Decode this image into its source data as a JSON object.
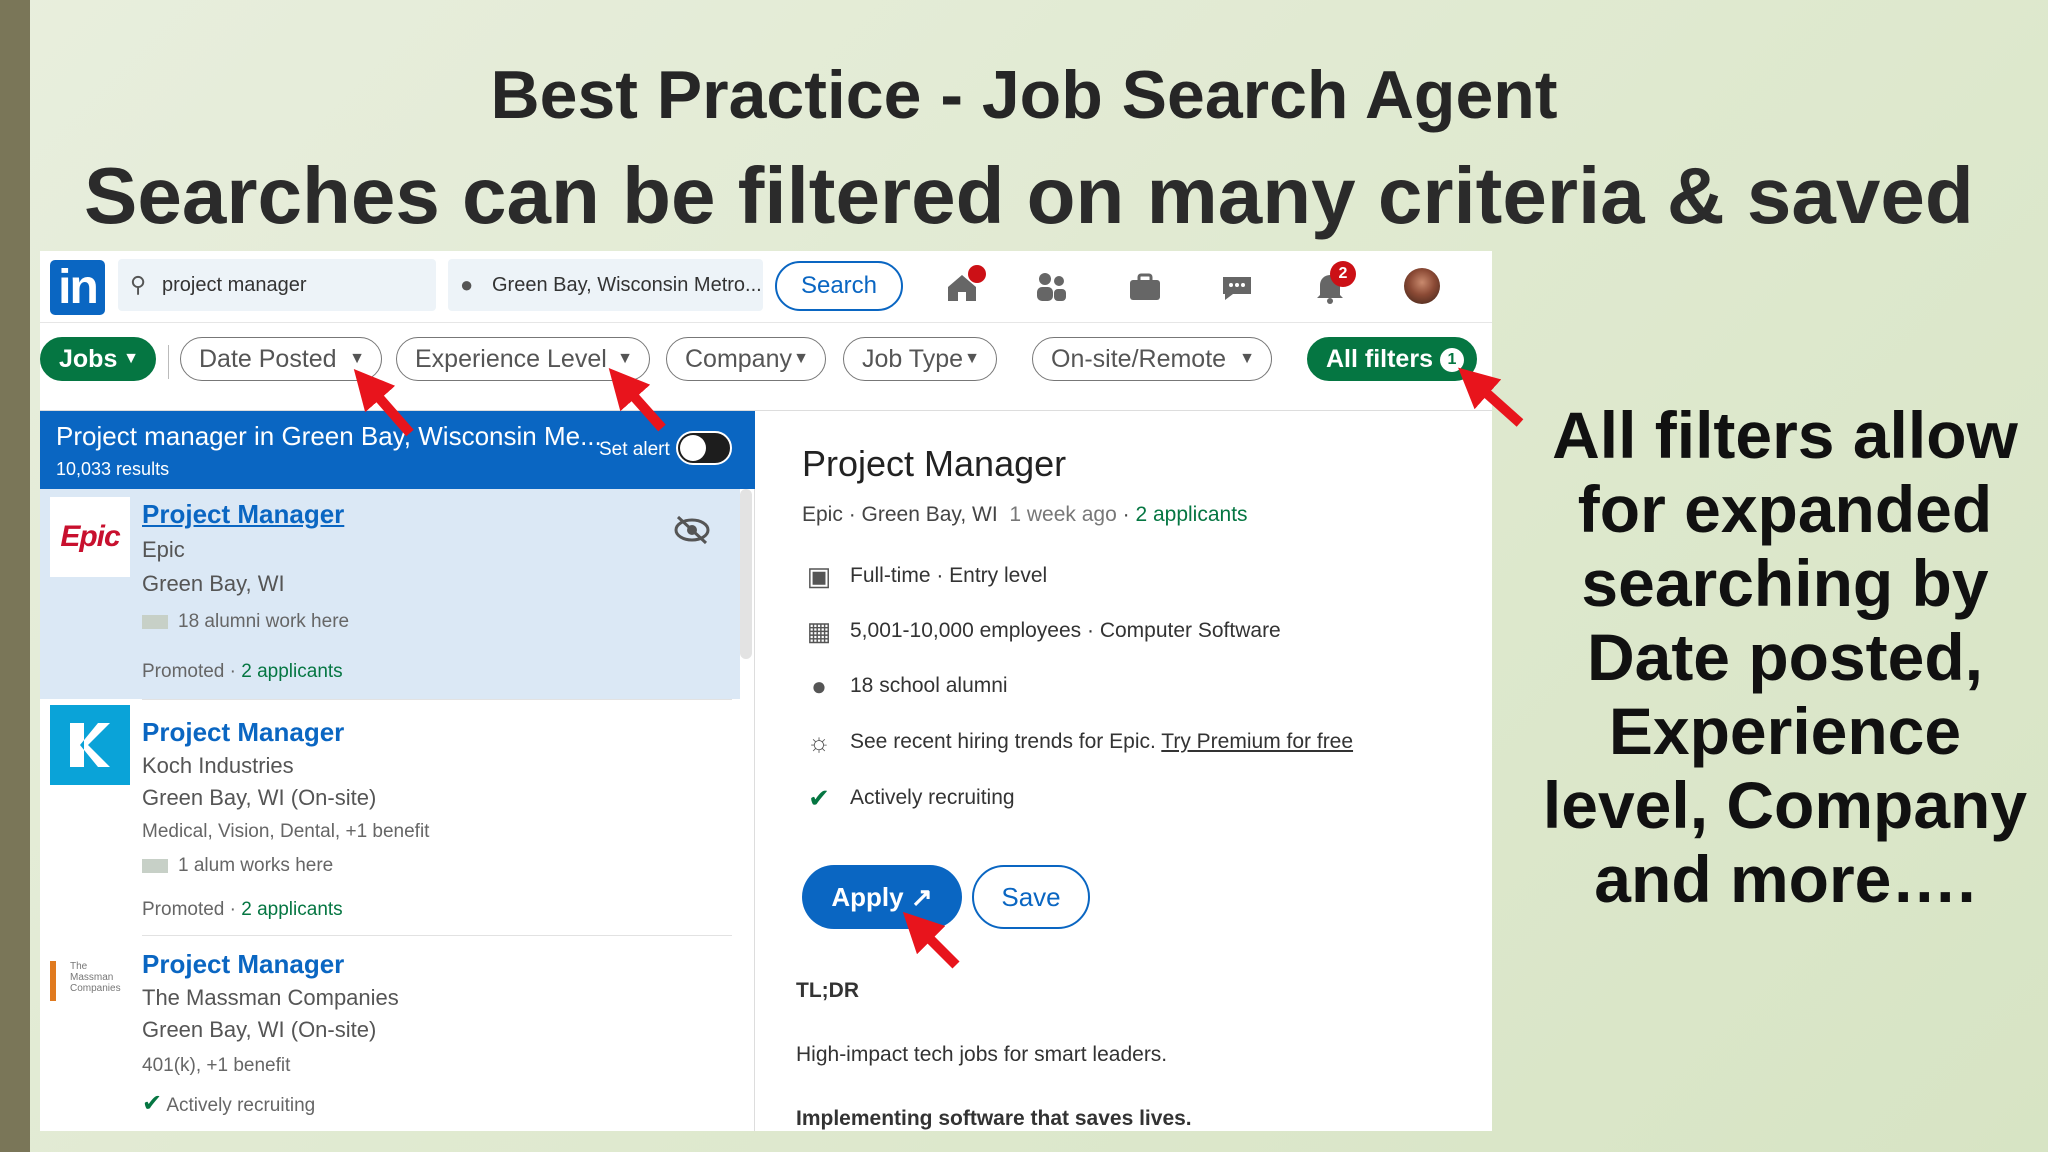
{
  "slide": {
    "title": "Best Practice - Job Search Agent",
    "subtitle": "Searches can be filtered on many criteria & saved",
    "side_note": "All filters allow for expanded searching by Date posted, Experience level, Company and more…."
  },
  "nav": {
    "logo": "in",
    "search_value": "project manager",
    "location_value": "Green Bay, Wisconsin Metro...",
    "search_button": "Search",
    "icons": [
      "home-icon",
      "people-icon",
      "briefcase-icon",
      "messaging-icon",
      "bell-icon"
    ],
    "notifications_count": "2"
  },
  "filters": {
    "jobs": "Jobs",
    "date_posted": "Date Posted",
    "experience_level": "Experience Level",
    "company": "Company",
    "job_type": "Job Type",
    "onsite_remote": "On-site/Remote",
    "all_filters": "All filters",
    "all_filters_count": "1"
  },
  "results": {
    "title": "Project manager in Green Bay, Wisconsin Me...",
    "count": "10,033 results",
    "set_alert": "Set alert",
    "jobs": [
      {
        "title": "Project Manager",
        "company": "Epic",
        "location": "Green Bay, WI",
        "alumni": "18 alumni work here",
        "promoted": "Promoted",
        "applicants": "2 applicants",
        "logo_text": "Epic"
      },
      {
        "title": "Project Manager",
        "company": "Koch Industries",
        "location": "Green Bay, WI (On-site)",
        "benefits": "Medical, Vision, Dental, +1 benefit",
        "alumni": "1 alum works here",
        "promoted": "Promoted",
        "applicants": "2 applicants",
        "logo_text": "K"
      },
      {
        "title": "Project Manager",
        "company": "The Massman Companies",
        "location": "Green Bay, WI (On-site)",
        "benefits": "401(k), +1 benefit",
        "recruiting": "Actively recruiting",
        "logo_text": "The Massman Companies"
      }
    ]
  },
  "detail": {
    "title": "Project Manager",
    "company": "Epic",
    "location": "Green Bay, WI",
    "posted": "1 week ago",
    "applicants": "2 applicants",
    "facts": {
      "type": "Full-time · Entry level",
      "size": "5,001-10,000 employees · Computer Software",
      "alumni": "18 school alumni",
      "trends": "See recent hiring trends for Epic.",
      "premium_link": "Try Premium for free",
      "recruiting": "Actively recruiting"
    },
    "apply": "Apply",
    "save": "Save",
    "tldr": "TL;DR",
    "line1": "High-impact tech jobs for smart leaders.",
    "line2": "Implementing software that saves lives."
  },
  "colors": {
    "linkedin_blue": "#0a66c2",
    "green": "#057642",
    "arrow_red": "#e8141c",
    "slide_bg": "#dfe9cf"
  }
}
